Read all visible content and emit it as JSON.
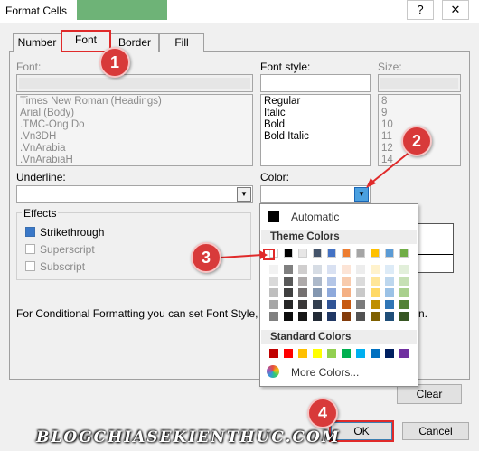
{
  "window": {
    "title": "Format Cells",
    "help_label": "?",
    "close_label": "✕"
  },
  "tabs": [
    {
      "label": "Number"
    },
    {
      "label": "Font"
    },
    {
      "label": "Border"
    },
    {
      "label": "Fill"
    }
  ],
  "font": {
    "font_label": "Font:",
    "font_list": [
      "Times New Roman (Headings)",
      "Arial (Body)",
      ".TMC-Ong Do",
      ".Vn3DH",
      ".VnArabia",
      ".VnArabiaH"
    ],
    "style_label": "Font style:",
    "style_list": [
      "Regular",
      "Italic",
      "Bold",
      "Bold Italic"
    ],
    "size_label": "Size:",
    "size_list": [
      "8",
      "9",
      "10",
      "11",
      "12",
      "14"
    ],
    "underline_label": "Underline:",
    "color_label": "Color:",
    "dropdown_arrow": "▼"
  },
  "effects": {
    "legend": "Effects",
    "strikethrough": {
      "label": "Strikethrough",
      "checked": true
    },
    "superscript": {
      "label": "Superscript",
      "checked": false
    },
    "subscript": {
      "label": "Subscript",
      "checked": false
    }
  },
  "info_text": "For Conditional Formatting you can set Font Style, U",
  "info_text_tail": "n.",
  "color_popup": {
    "automatic_label": "Automatic",
    "theme_colors_label": "Theme Colors",
    "standard_colors_label": "Standard Colors",
    "more_colors_label": "More Colors...",
    "theme_top": [
      "#ffffff",
      "#000000",
      "#e7e6e6",
      "#44546a",
      "#4472c4",
      "#ed7d31",
      "#a5a5a5",
      "#ffc000",
      "#5b9bd5",
      "#70ad47"
    ],
    "theme_shades": [
      [
        "#f2f2f2",
        "#d9d9d9",
        "#bfbfbf",
        "#a6a6a6",
        "#808080"
      ],
      [
        "#808080",
        "#595959",
        "#404040",
        "#262626",
        "#0d0d0d"
      ],
      [
        "#d0cece",
        "#aeaaaa",
        "#757171",
        "#3a3838",
        "#161616"
      ],
      [
        "#d6dce4",
        "#adb9ca",
        "#8497b0",
        "#333f4f",
        "#222a35"
      ],
      [
        "#d9e1f2",
        "#b4c6e7",
        "#8ea9db",
        "#305496",
        "#203764"
      ],
      [
        "#fce4d6",
        "#f8cbad",
        "#f4b084",
        "#c65911",
        "#833c0c"
      ],
      [
        "#ededed",
        "#dbdbdb",
        "#c9c9c9",
        "#7b7b7b",
        "#525252"
      ],
      [
        "#fff2cc",
        "#ffe699",
        "#ffd966",
        "#bf8f00",
        "#7f6000"
      ],
      [
        "#ddebf7",
        "#bdd7ee",
        "#9bc2e6",
        "#2f75b5",
        "#1f4e78"
      ],
      [
        "#e2efda",
        "#c6e0b4",
        "#a9d08e",
        "#548235",
        "#375623"
      ]
    ],
    "standard": [
      "#c00000",
      "#ff0000",
      "#ffc000",
      "#ffff00",
      "#92d050",
      "#00b050",
      "#00b0f0",
      "#0070c0",
      "#002060",
      "#7030a0"
    ]
  },
  "buttons": {
    "clear_label": "Clear",
    "ok_label": "OK",
    "cancel_label": "Cancel"
  },
  "markers": [
    "1",
    "2",
    "3",
    "4"
  ],
  "watermark": "BLOGCHIASEKIENTHUC.COM"
}
